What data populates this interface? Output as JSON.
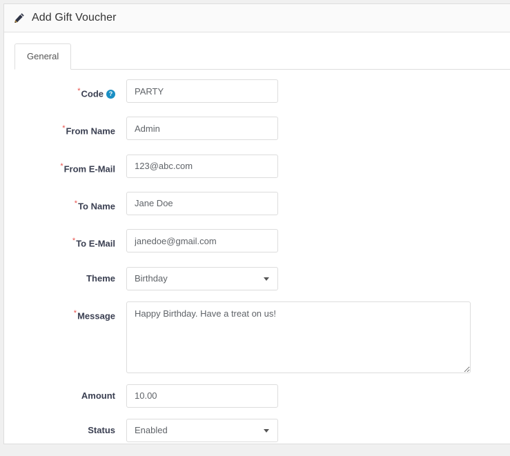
{
  "header": {
    "title": "Add Gift Voucher",
    "icon": "pencil-icon"
  },
  "tabs": [
    {
      "label": "General",
      "active": true
    }
  ],
  "form": {
    "required_marker": "*",
    "help_icon_glyph": "?",
    "fields": [
      {
        "key": "code",
        "label": "Code",
        "required": true,
        "help": true,
        "type": "text",
        "value": "PARTY",
        "placeholder": ""
      },
      {
        "key": "from_name",
        "label": "From Name",
        "required": true,
        "help": false,
        "type": "text",
        "value": "Admin",
        "placeholder": ""
      },
      {
        "key": "from_email",
        "label": "From E-Mail",
        "required": true,
        "help": false,
        "type": "text",
        "value": "123@abc.com",
        "placeholder": ""
      },
      {
        "key": "to_name",
        "label": "To Name",
        "required": true,
        "help": false,
        "type": "text",
        "value": "Jane Doe",
        "placeholder": ""
      },
      {
        "key": "to_email",
        "label": "To E-Mail",
        "required": true,
        "help": false,
        "type": "text",
        "value": "janedoe@gmail.com",
        "placeholder": ""
      },
      {
        "key": "theme",
        "label": "Theme",
        "required": false,
        "help": false,
        "type": "select",
        "value": "Birthday",
        "options": [
          "Birthday"
        ]
      },
      {
        "key": "message",
        "label": "Message",
        "required": true,
        "help": false,
        "type": "textarea",
        "value": "Happy Birthday. Have a treat on us!",
        "placeholder": ""
      },
      {
        "key": "amount",
        "label": "Amount",
        "required": false,
        "help": false,
        "type": "text",
        "value": "10.00",
        "placeholder": ""
      },
      {
        "key": "status",
        "label": "Status",
        "required": false,
        "help": false,
        "type": "select",
        "value": "Enabled",
        "options": [
          "Enabled"
        ]
      }
    ]
  },
  "colors": {
    "required_red": "#e8504a",
    "help_blue": "#1a8fc4",
    "label_text": "#3a3f51",
    "input_text": "#5f6368",
    "border": "#dcdcdc",
    "panel_border": "#dddddd",
    "header_bg": "#fafafa",
    "page_bg": "#f0f0f0"
  }
}
